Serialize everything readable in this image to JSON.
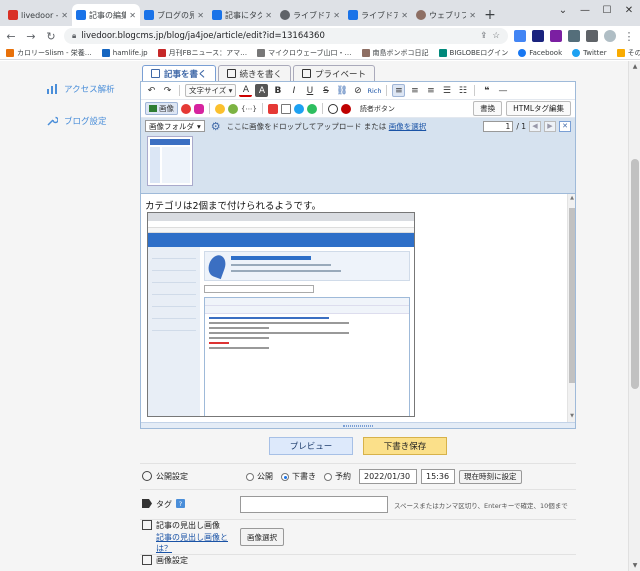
{
  "browser": {
    "tabs": [
      {
        "title": "livedoor -",
        "fav": "#d93025",
        "active": false
      },
      {
        "title": "記事の編集",
        "fav": "#1a73e8",
        "active": true
      },
      {
        "title": "ブログの見出",
        "fav": "#1a73e8",
        "active": false
      },
      {
        "title": "記事にタグを",
        "fav": "#1a73e8",
        "active": false
      },
      {
        "title": "ライブドアブ",
        "fav": "#5f6368",
        "active": false
      },
      {
        "title": "ライブドアブ",
        "fav": "#1a73e8",
        "active": false
      },
      {
        "title": "ウェブリブロ",
        "fav": "#8d6e63",
        "active": false
      }
    ],
    "new_tab": "+",
    "url": "livedoor.blogcms.jp/blog/ja4joe/article/edit?id=13164360",
    "bookmarks": [
      {
        "label": "カロリーSlism - 栄養…",
        "color": "#e8710a"
      },
      {
        "label": "hamlife.jp",
        "color": "#1565c0"
      },
      {
        "label": "月刊FBニュース：アマ…",
        "color": "#c62828"
      },
      {
        "label": "マイクロウェーブ山口・…",
        "color": "#777777"
      },
      {
        "label": "南島ボンボコ日記",
        "color": "#8d6e63"
      },
      {
        "label": "BIGLOBEログイン",
        "color": "#00897b"
      },
      {
        "label": "Facebook",
        "color": "#1877f2"
      },
      {
        "label": "Twitter",
        "color": "#1da1f2"
      },
      {
        "label": "その他のブックマーク",
        "color": "#f9ab00"
      }
    ]
  },
  "sidebar": {
    "items": [
      {
        "label": "アクセス解析",
        "icon": "bar-chart-icon"
      },
      {
        "label": "ブログ設定",
        "icon": "wrench-icon"
      }
    ]
  },
  "editor": {
    "tabs": [
      "記事を書く",
      "続きを書く",
      "プライベート"
    ],
    "toolbar": {
      "font_size_label": "文字サイズ",
      "rich_label": "Rich",
      "image_label": "画像",
      "reader_button": "読者ボタン",
      "undo_label": "書換",
      "html_tag_edit": "HTMLタグ編集"
    },
    "image_panel": {
      "folder_select": "画像フォルダ",
      "drop_text": "ここに画像をドロップしてアップロード または",
      "select_link": "画像を選択",
      "page_current": "1",
      "page_total": "/ 1"
    },
    "content_text": "カテゴリは2個まで付けられるようです。"
  },
  "actions": {
    "preview": "プレビュー",
    "save_draft": "下書き保存"
  },
  "settings": {
    "publish": {
      "label": "公開設定",
      "options": [
        "公開",
        "下書き",
        "予約"
      ],
      "selected": "下書き",
      "date": "2022/01/30",
      "time": "15:36",
      "now_button": "現在時刻に設定"
    },
    "tags": {
      "label": "タグ",
      "help": "?",
      "note": "スペースまたはカンマ区切り、Enterキーで確定、10個まで"
    },
    "heading_image": {
      "label": "記事の見出し画像",
      "help_link": "記事の見出し画像とは？",
      "button": "画像選択"
    },
    "next_section": "画像設定"
  }
}
